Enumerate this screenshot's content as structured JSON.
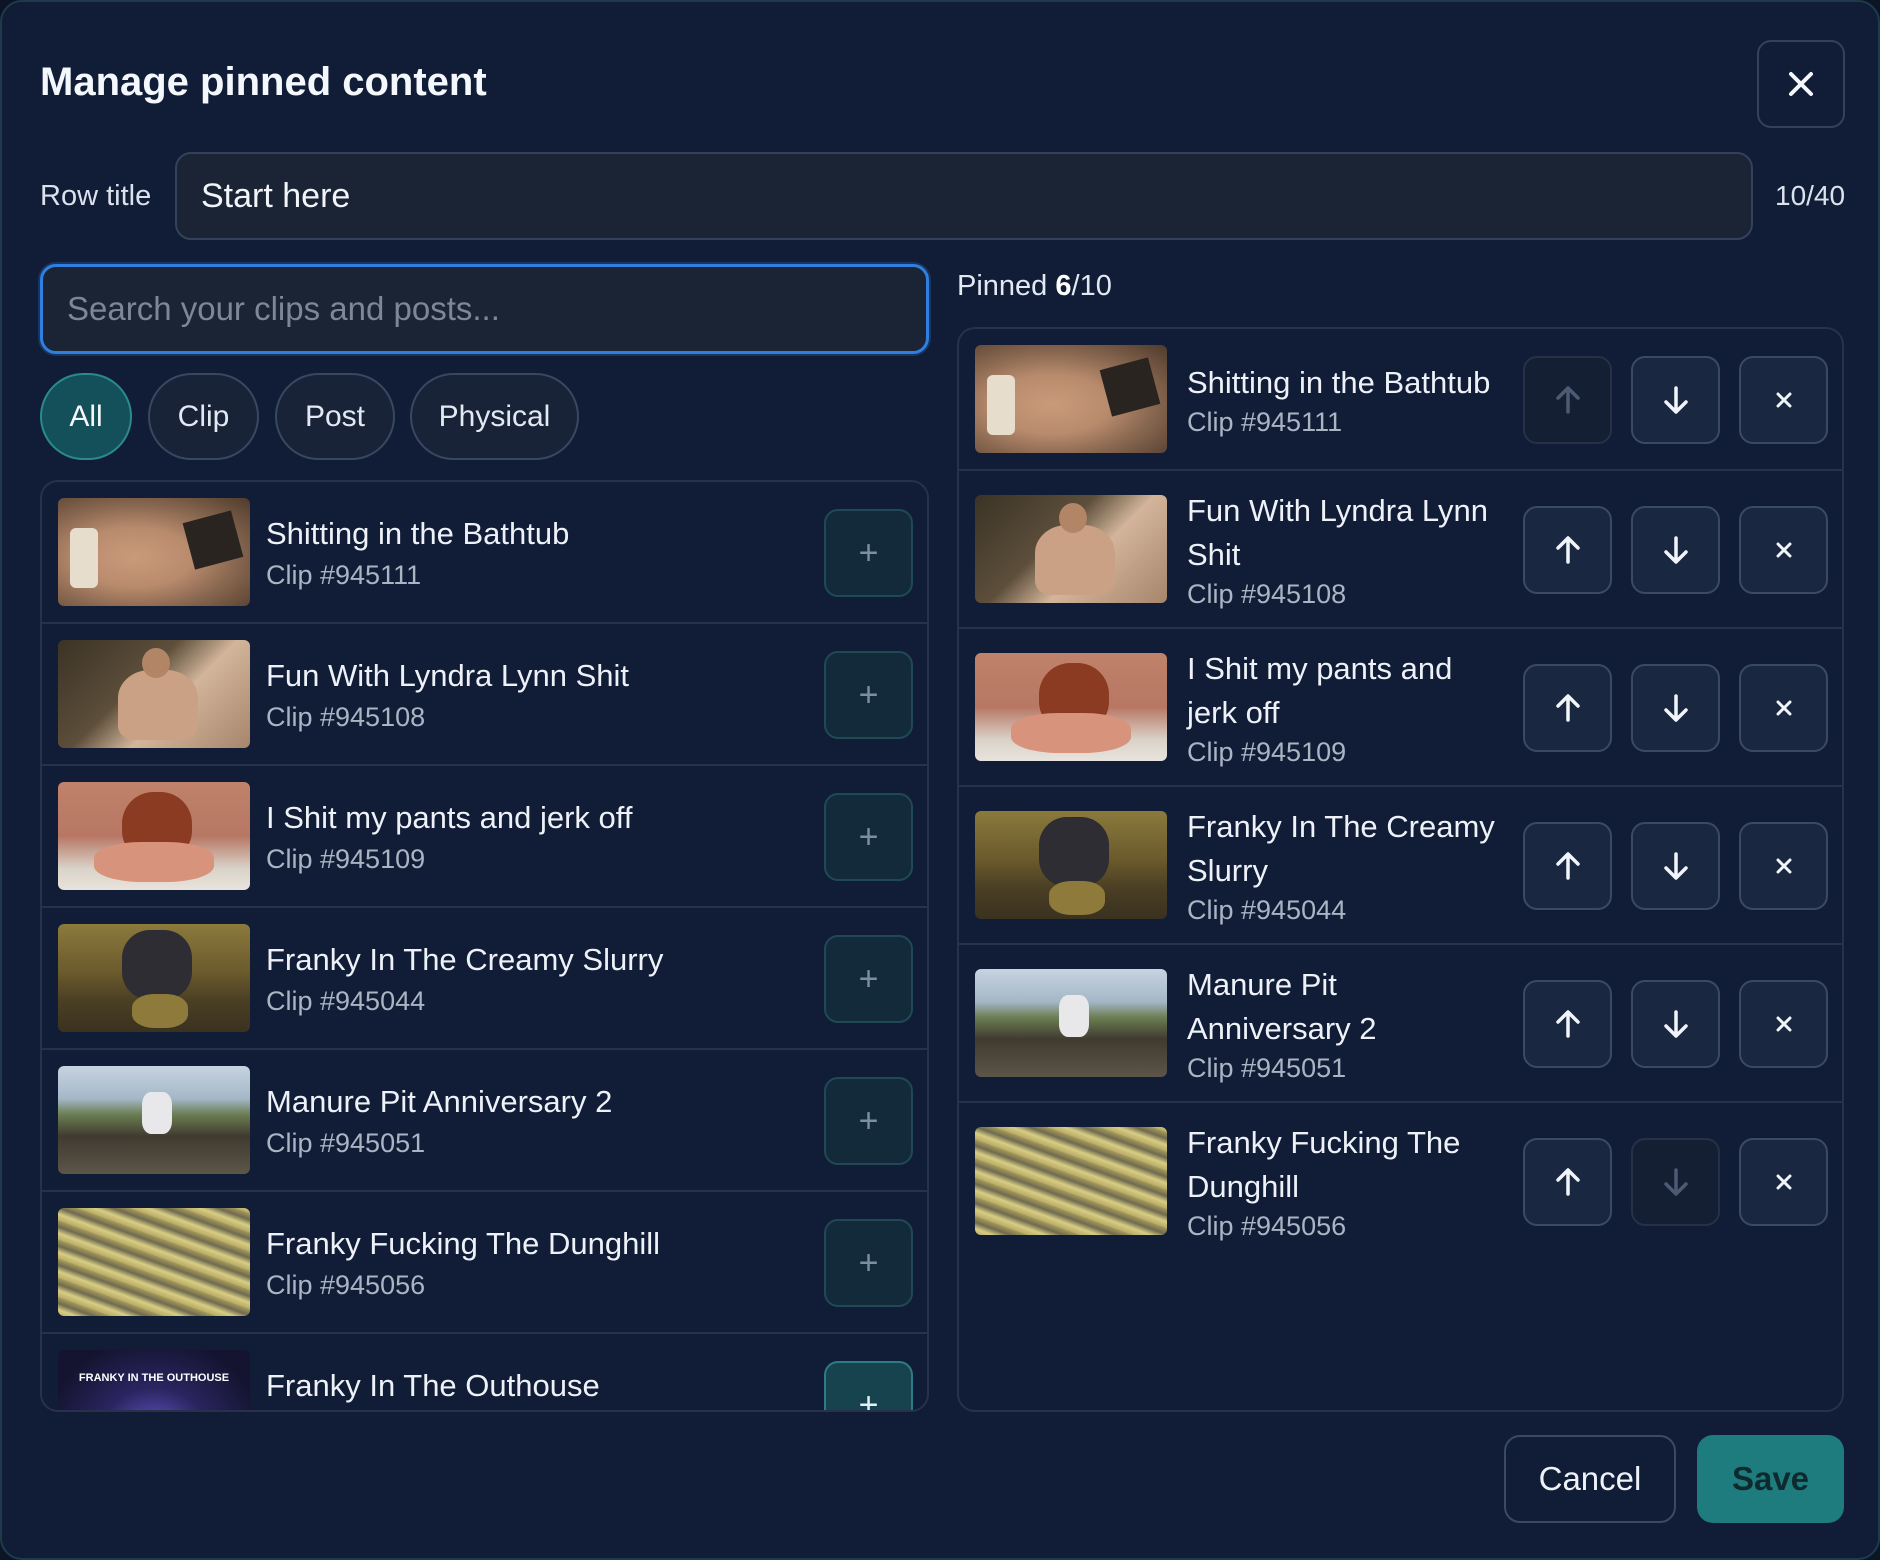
{
  "dialog": {
    "title": "Manage pinned content"
  },
  "row_title": {
    "label": "Row title",
    "value": "Start here",
    "count": "10/40"
  },
  "search": {
    "placeholder": "Search your clips and posts..."
  },
  "filters": [
    "All",
    "Clip",
    "Post",
    "Physical"
  ],
  "active_filter": "All",
  "items": [
    {
      "title": "Shitting in the Bathtub",
      "sub": "Clip #945111"
    },
    {
      "title": "Fun With Lyndra Lynn Shit",
      "sub": "Clip #945108"
    },
    {
      "title": "I Shit my pants and jerk off",
      "sub": "Clip #945109"
    },
    {
      "title": "Franky In The Creamy Slurry",
      "sub": "Clip #945044"
    },
    {
      "title": "Manure Pit Anniversary 2",
      "sub": "Clip #945051"
    },
    {
      "title": "Franky Fucking The Dunghill",
      "sub": "Clip #945056"
    },
    {
      "title": "Franky In The Outhouse",
      "sub": ""
    }
  ],
  "thumb_caption_outhouse": "FRANKY IN THE OUTHOUSE",
  "pinned": {
    "label": "Pinned",
    "count": "6",
    "max": "/10",
    "items": [
      {
        "title": "Shitting in the Bathtub",
        "sub": "Clip #945111"
      },
      {
        "title": "Fun With Lyndra Lynn Shit",
        "sub": "Clip #945108"
      },
      {
        "title": "I Shit my pants and jerk off",
        "sub": "Clip #945109"
      },
      {
        "title": "Franky In The Creamy Slurry",
        "sub": "Clip #945044"
      },
      {
        "title": "Manure Pit Anniversary 2",
        "sub": "Clip #945051"
      },
      {
        "title": "Franky Fucking The Dunghill",
        "sub": "Clip #945056"
      }
    ]
  },
  "footer": {
    "cancel": "Cancel",
    "save": "Save"
  },
  "colors": {
    "accent": "#1e7b7e",
    "focus": "#2f7fe0",
    "background": "#111d36"
  }
}
